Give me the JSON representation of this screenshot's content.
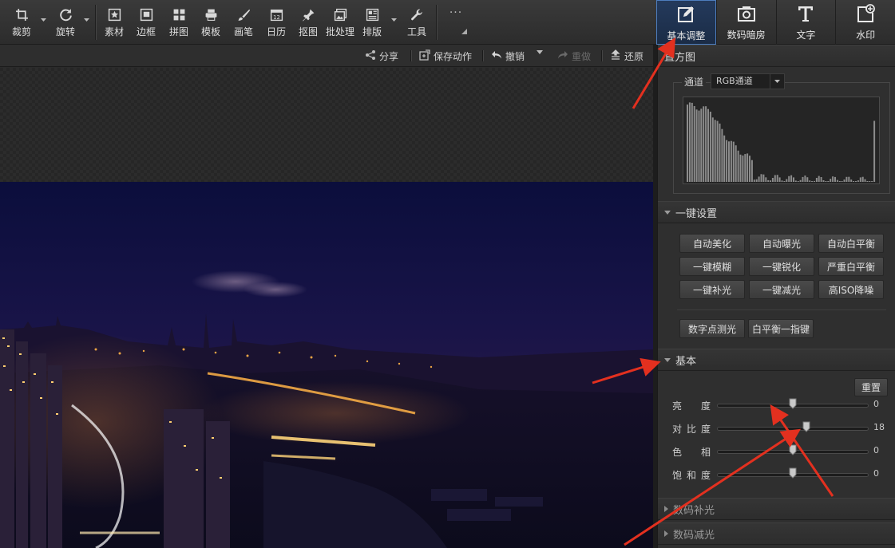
{
  "toolbar": {
    "tools": [
      {
        "label": "裁剪",
        "icon": "crop-icon"
      },
      {
        "label": "旋转",
        "icon": "rotate-icon"
      },
      {
        "label": "素材",
        "icon": "material-icon"
      },
      {
        "label": "边框",
        "icon": "frame-icon"
      },
      {
        "label": "拼图",
        "icon": "collage-icon"
      },
      {
        "label": "模板",
        "icon": "template-icon"
      },
      {
        "label": "画笔",
        "icon": "brush-icon"
      },
      {
        "label": "日历",
        "icon": "calendar-icon"
      },
      {
        "label": "抠图",
        "icon": "cutout-icon"
      },
      {
        "label": "批处理",
        "icon": "batch-icon"
      },
      {
        "label": "排版",
        "icon": "layout-icon"
      },
      {
        "label": "工具",
        "icon": "wrench-icon"
      }
    ],
    "more": "···"
  },
  "right_tabs": [
    {
      "label": "基本调整",
      "icon": "adjust-icon",
      "active": true
    },
    {
      "label": "数码暗房",
      "icon": "darkroom-icon",
      "active": false
    },
    {
      "label": "文字",
      "icon": "text-icon",
      "active": false
    },
    {
      "label": "水印",
      "icon": "watermark-icon",
      "active": false
    }
  ],
  "actions": {
    "share": "分享",
    "save_action": "保存动作",
    "undo": "撤销",
    "redo": "重做",
    "restore": "还原"
  },
  "panel": {
    "histogram": {
      "title": "直方图",
      "channel_label": "通道",
      "channel_value": "RGB通道"
    },
    "one_click": {
      "title": "一键设置",
      "buttons": [
        "自动美化",
        "自动曝光",
        "自动白平衡",
        "一键模糊",
        "一键锐化",
        "严重白平衡",
        "一键补光",
        "一键减光",
        "高ISO降噪"
      ],
      "extra_buttons": [
        "数字点测光",
        "白平衡一指键"
      ]
    },
    "basic": {
      "title": "基本",
      "reset": "重置",
      "sliders": [
        {
          "label": [
            "亮",
            "",
            "度"
          ],
          "value": "0",
          "level": 0.5
        },
        {
          "label": [
            "对",
            "比",
            "度"
          ],
          "value": "18",
          "level": 0.59
        },
        {
          "label": [
            "色",
            "",
            "相"
          ],
          "value": "0",
          "level": 0.5
        },
        {
          "label": [
            "饱",
            "和",
            "度"
          ],
          "value": "0",
          "level": 0.5
        }
      ]
    },
    "fill_light": {
      "title": "数码补光"
    },
    "reduce_light": {
      "title": "数码减光"
    }
  },
  "colors": {
    "accent_tab": "#1f3556",
    "annotation_arrow": "#e3301f"
  }
}
